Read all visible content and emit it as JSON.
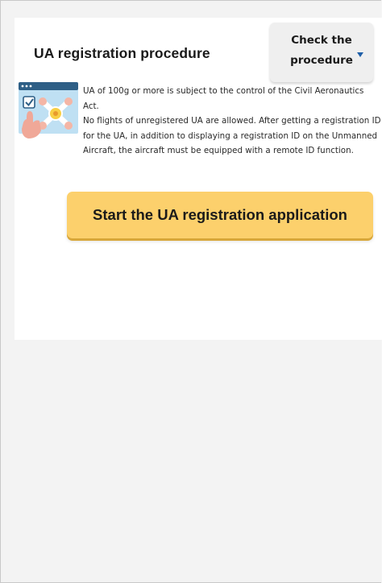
{
  "section": {
    "title": "UA registration procedure",
    "check_button_label": "Check the\nprocedure",
    "description": {
      "line1": "UA of 100g or more is subject to the control of the Civil Aeronautics Act.",
      "line2": "No flights of unregistered UA are allowed. After getting a registration ID for the UA, in addition to displaying a registration ID on the Unmanned Aircraft, the aircraft must be equipped with a remote ID function."
    },
    "start_button_label": "Start the UA registration application",
    "illustration_icon": "drone-registration-icon"
  },
  "colors": {
    "start_button": "#fcd06c",
    "check_button": "#efefef",
    "caret": "#1f5fa8",
    "card_background": "#ffffff",
    "page_background": "#f3f3f3"
  }
}
